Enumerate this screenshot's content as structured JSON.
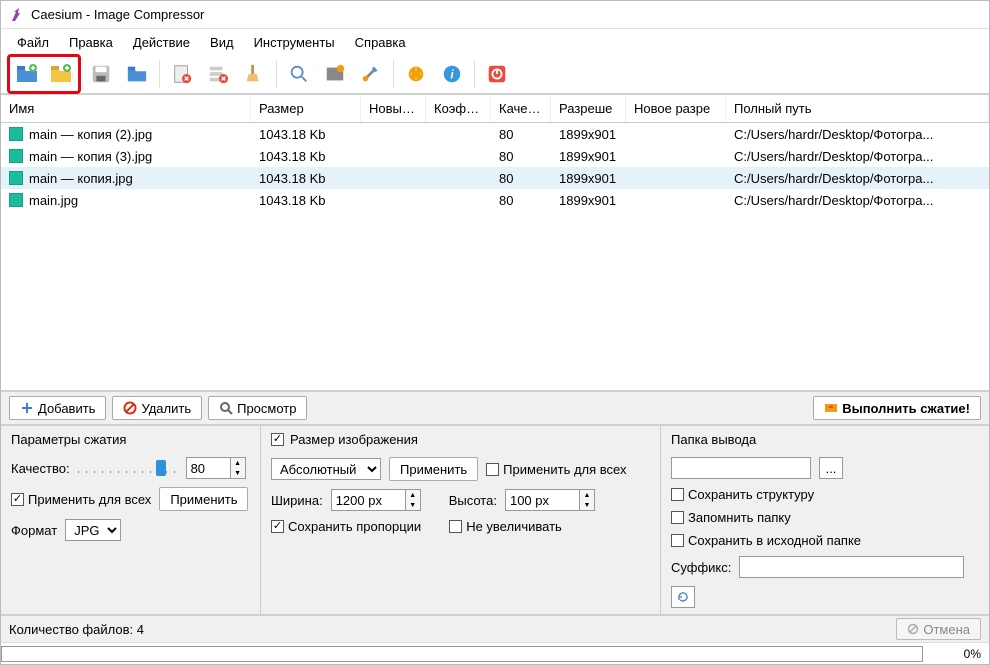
{
  "title": "Caesium - Image Compressor",
  "menu": [
    "Файл",
    "Правка",
    "Действие",
    "Вид",
    "Инструменты",
    "Справка"
  ],
  "columns": {
    "name": "Имя",
    "size": "Размер",
    "newsize": "Новый р",
    "ratio": "Коэффи",
    "quality": "Качеств",
    "res": "Разреше",
    "newres": "Новое разре",
    "path": "Полный путь"
  },
  "files": [
    {
      "name": "main — копия (2).jpg",
      "size": "1043.18 Kb",
      "quality": "80",
      "res": "1899x901",
      "path": "C:/Users/hardr/Desktop/Фотогра...",
      "selected": false
    },
    {
      "name": "main — копия (3).jpg",
      "size": "1043.18 Kb",
      "quality": "80",
      "res": "1899x901",
      "path": "C:/Users/hardr/Desktop/Фотогра...",
      "selected": false
    },
    {
      "name": "main — копия.jpg",
      "size": "1043.18 Kb",
      "quality": "80",
      "res": "1899x901",
      "path": "C:/Users/hardr/Desktop/Фотогра...",
      "selected": true
    },
    {
      "name": "main.jpg",
      "size": "1043.18 Kb",
      "quality": "80",
      "res": "1899x901",
      "path": "C:/Users/hardr/Desktop/Фотогра...",
      "selected": false
    }
  ],
  "actions": {
    "add": "Добавить",
    "delete": "Удалить",
    "preview": "Просмотр",
    "compress": "Выполнить сжатие!"
  },
  "compression": {
    "header": "Параметры сжатия",
    "quality_label": "Качество:",
    "quality_value": "80",
    "apply_all": "Применить для всех",
    "apply": "Применить",
    "format_label": "Формат",
    "format_value": "JPG"
  },
  "image_size": {
    "header": "Размер изображения",
    "mode": "Абсолютный",
    "apply": "Применить",
    "apply_all": "Применить для всех",
    "width_label": "Ширина:",
    "width_value": "1200 px",
    "height_label": "Высота:",
    "height_value": "100 px",
    "keep_ratio": "Сохранить пропорции",
    "no_enlarge": "Не увеличивать"
  },
  "output": {
    "header": "Папка вывода",
    "browse": "...",
    "keep_structure": "Сохранить структуру",
    "remember": "Запомнить папку",
    "same_folder": "Сохранить в исходной папке",
    "suffix_label": "Суффикс:"
  },
  "status": {
    "count": "Количество файлов: 4",
    "cancel": "Отмена",
    "progress": "0%"
  }
}
